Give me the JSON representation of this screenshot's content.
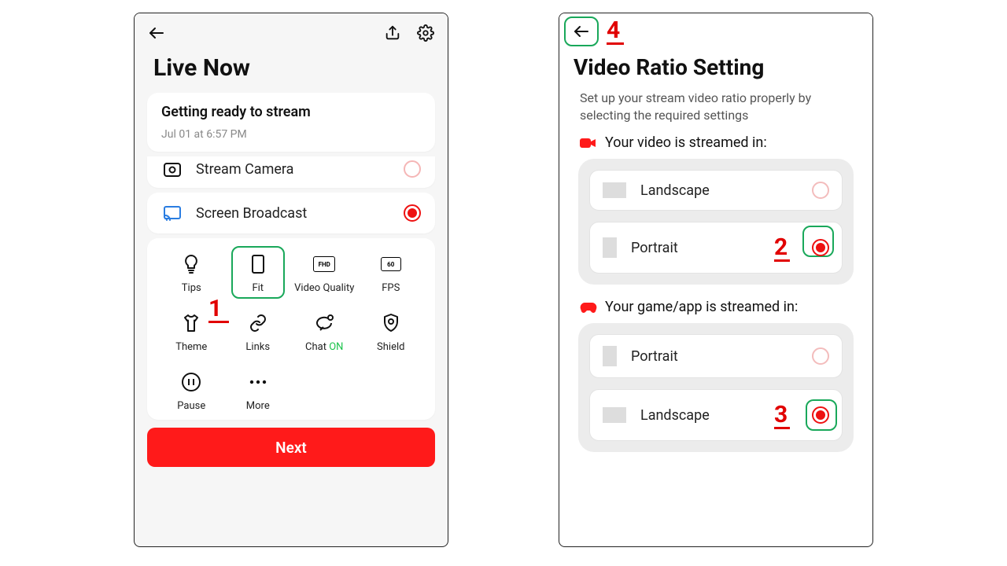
{
  "annotations": {
    "a1": "1",
    "a2": "2",
    "a3": "3",
    "a4": "4"
  },
  "left": {
    "title": "Live Now",
    "status": {
      "heading": "Getting ready to stream",
      "time": "Jul 01 at 6:57 PM"
    },
    "options": {
      "camera": "Stream Camera",
      "broadcast": "Screen Broadcast"
    },
    "tools": {
      "tips": "Tips",
      "fit": "Fit",
      "vq": "Video Quality",
      "fps": "FPS",
      "theme": "Theme",
      "links": "Links",
      "chat_prefix": "Chat ",
      "chat_state": "ON",
      "shield": "Shield",
      "pause": "Pause",
      "more": "More",
      "fhd_badge": "FHD",
      "fps_badge": "60"
    },
    "next": "Next"
  },
  "right": {
    "title": "Video Ratio Setting",
    "desc": "Set up your stream video ratio properly by selecting the required settings",
    "video_label": "Your video is streamed in:",
    "game_label": "Your game/app is streamed in:",
    "landscape": "Landscape",
    "portrait": "Portrait"
  }
}
